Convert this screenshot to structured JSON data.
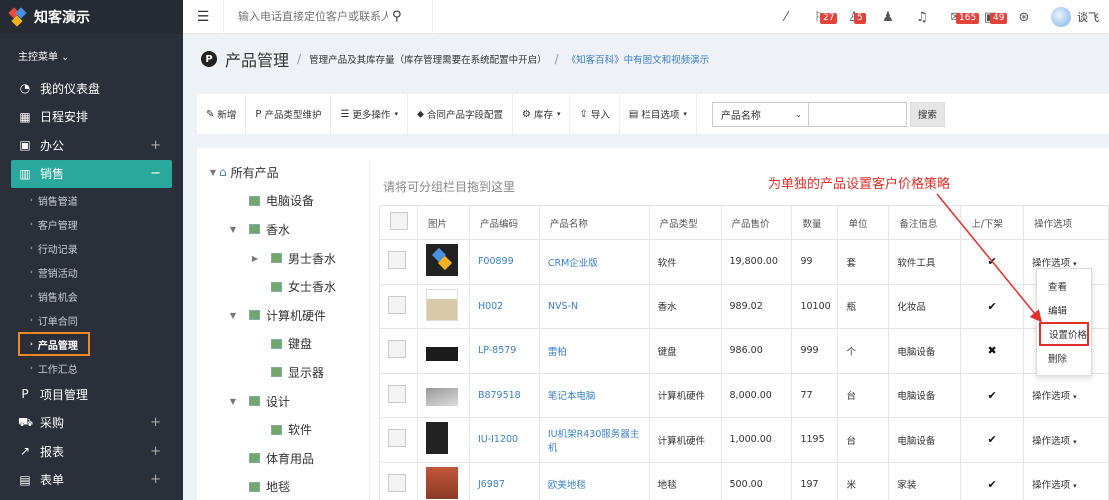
{
  "app": {
    "name": "知客演示"
  },
  "sidebar": {
    "menu_label": "主控菜单 ⌄",
    "items": [
      {
        "label": "我的仪表盘",
        "icon": "dashboard-icon",
        "glyph": "◔"
      },
      {
        "label": "日程安排",
        "icon": "calendar-icon",
        "glyph": "▦"
      },
      {
        "label": "办公",
        "icon": "briefcase-icon",
        "glyph": "▣",
        "plus": "+"
      },
      {
        "label": "销售",
        "icon": "chart-icon",
        "glyph": "▥",
        "plus": "−"
      }
    ],
    "sub_items": [
      {
        "label": "销售管道"
      },
      {
        "label": "客户管理"
      },
      {
        "label": "行动记录"
      },
      {
        "label": "营销活动"
      },
      {
        "label": "销售机会"
      },
      {
        "label": "订单合同"
      },
      {
        "label": "产品管理"
      },
      {
        "label": "工作汇总"
      }
    ],
    "items_after": [
      {
        "label": "项目管理",
        "icon": "project-icon",
        "glyph": "P"
      },
      {
        "label": "采购",
        "icon": "truck-icon",
        "glyph": "⛟",
        "plus": "+"
      },
      {
        "label": "报表",
        "icon": "report-icon",
        "glyph": "↗",
        "plus": "+"
      },
      {
        "label": "表单",
        "icon": "form-icon",
        "glyph": "▤",
        "plus": "+"
      }
    ]
  },
  "topbar": {
    "search_placeholder": "输入电话直接定位客户或联系人",
    "badges": {
      "flag": "27",
      "user": "5",
      "mail": "165",
      "gift": "49"
    },
    "user_name": "谈飞"
  },
  "page": {
    "title": "产品管理",
    "description": "管理产品及其库存量（库存管理需要在系统配置中开启）",
    "link": "《知客百科》中有图文和视频演示"
  },
  "toolbar": {
    "buttons": [
      {
        "label": "新增",
        "glyph": "✎"
      },
      {
        "label": "产品类型维护",
        "glyph": "P"
      },
      {
        "label": "更多操作",
        "glyph": "☰",
        "caret": "▾"
      },
      {
        "label": "合同产品字段配置",
        "glyph": "⬥"
      },
      {
        "label": "库存",
        "glyph": "⚙",
        "caret": "▾"
      },
      {
        "label": "导入",
        "glyph": "⇪"
      },
      {
        "label": "栏目选项",
        "glyph": "▤",
        "caret": "▾"
      }
    ],
    "select_value": "产品名称",
    "search_label": "搜索"
  },
  "tree": {
    "root": "所有产品",
    "nodes": [
      {
        "label": "电脑设备",
        "level": 1
      },
      {
        "label": "香水",
        "level": 1,
        "expanded": true
      },
      {
        "label": "男士香水",
        "level": 2,
        "collapsed": true
      },
      {
        "label": "女士香水",
        "level": 2
      },
      {
        "label": "计算机硬件",
        "level": 1,
        "expanded": true
      },
      {
        "label": "键盘",
        "level": 2
      },
      {
        "label": "显示器",
        "level": 2
      },
      {
        "label": "设计",
        "level": 1,
        "expanded": true
      },
      {
        "label": "软件",
        "level": 2
      },
      {
        "label": "体育用品",
        "level": 1
      },
      {
        "label": "地毯",
        "level": 1
      }
    ]
  },
  "group_hint": "请将可分组栏目拖到这里",
  "annotation": "为单独的产品设置客户价格策略",
  "table": {
    "headers": [
      "图片",
      "产品编码",
      "产品名称",
      "产品类型",
      "产品售价",
      "数量",
      "单位",
      "备注信息",
      "上/下架",
      "操作选项"
    ],
    "rows": [
      {
        "thumb": "crm",
        "code": "F00899",
        "name": "CRM企业版",
        "type": "软件",
        "price": "19,800.00",
        "qty": "99",
        "unit": "套",
        "note": "软件工具",
        "status": "✔",
        "op": "操作选项"
      },
      {
        "thumb": "perfume",
        "code": "H002",
        "name": "NVS-N",
        "type": "香水",
        "price": "989.02",
        "qty": "10100",
        "unit": "瓶",
        "note": "化妆品",
        "status": "✔",
        "op": ""
      },
      {
        "thumb": "keyboard",
        "code": "LP-8579",
        "name": "雷柏",
        "type": "键盘",
        "price": "986.00",
        "qty": "999",
        "unit": "个",
        "note": "电脑设备",
        "status": "✖",
        "op": ""
      },
      {
        "thumb": "laptop",
        "code": "B879518",
        "name": "笔记本电脑",
        "type": "计算机硬件",
        "price": "8,000.00",
        "qty": "77",
        "unit": "台",
        "note": "电脑设备",
        "status": "✔",
        "op": "操作选项"
      },
      {
        "thumb": "server",
        "code": "IU-I1200",
        "name": "IU机架R430服务器主机",
        "type": "计算机硬件",
        "price": "1,000.00",
        "qty": "1195",
        "unit": "台",
        "note": "电脑设备",
        "status": "✔",
        "op": "操作选项"
      },
      {
        "thumb": "carpet",
        "code": "J6987",
        "name": "欧美地毯",
        "type": "地毯",
        "price": "500.00",
        "qty": "197",
        "unit": "米",
        "note": "家装",
        "status": "✔",
        "op": "操作选项"
      }
    ]
  },
  "dropdown": {
    "items": [
      "查看",
      "编辑",
      "设置价格",
      "删除"
    ],
    "highlighted": "设置价格"
  },
  "colors": {
    "accent": "#2aa89c",
    "highlight": "#e0302a",
    "link": "#3c80c6"
  }
}
